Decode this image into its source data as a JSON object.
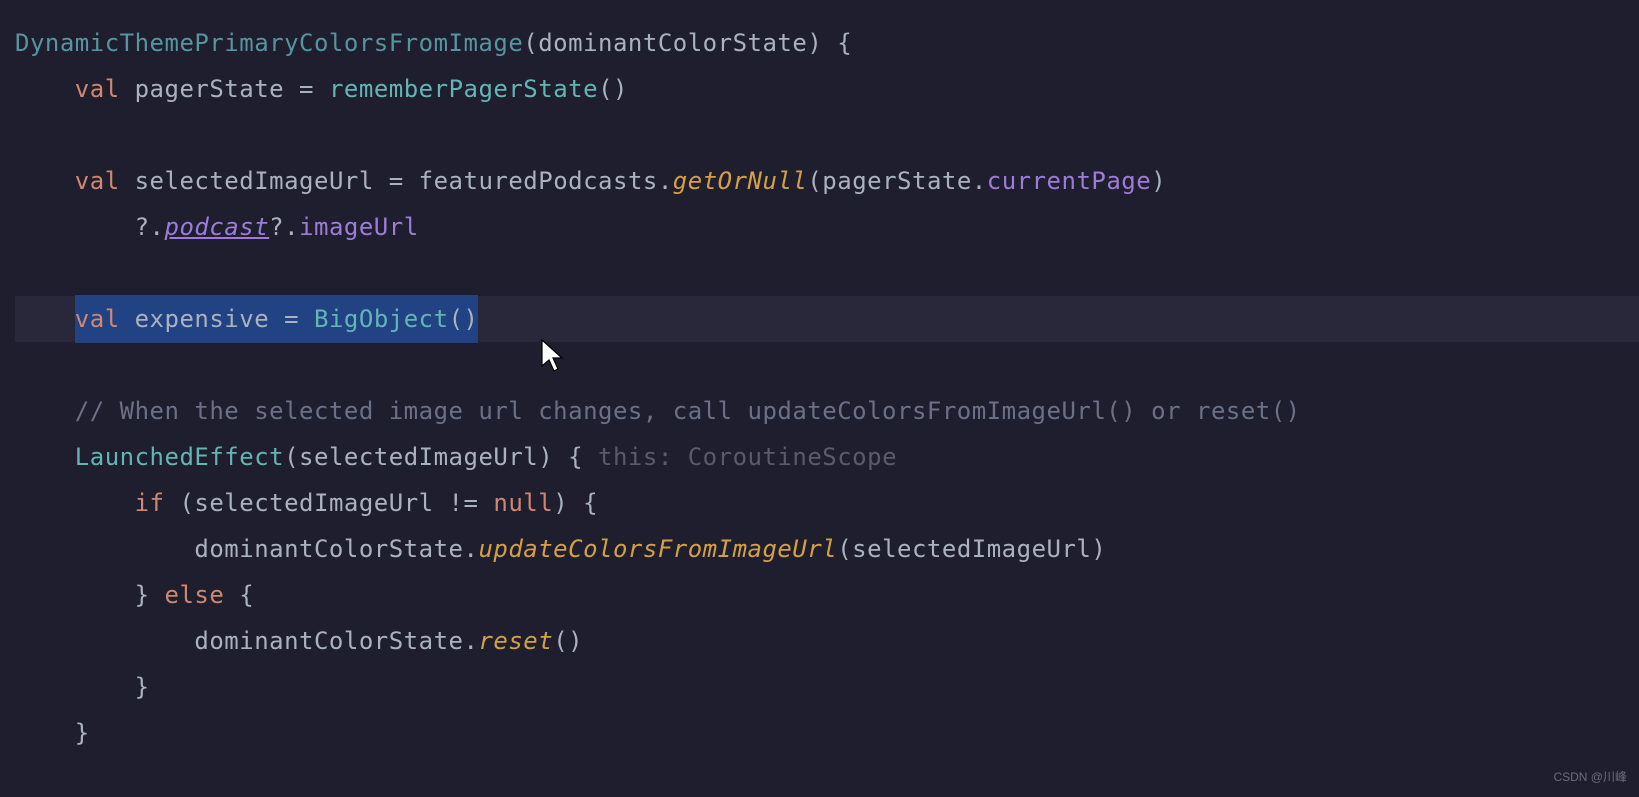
{
  "code": {
    "l1": {
      "funcName": "DynamicThemePrimaryColorsFromImage",
      "param": "dominantColorState",
      "brace": " {"
    },
    "l2": {
      "indent": "    ",
      "kw": "val",
      "sp": " ",
      "name": "pagerState",
      "eq": " = ",
      "func": "rememberPagerState",
      "parens": "()"
    },
    "l3": {
      "indent": "    ",
      "kw": "val",
      "sp": " ",
      "name": "selectedImageUrl",
      "eq": " = ",
      "obj": "featuredPodcasts",
      "dot": ".",
      "method": "getOrNull",
      "open": "(",
      "arg1": "pagerState",
      "dot2": ".",
      "prop": "currentPage",
      "close": ")"
    },
    "l4": {
      "indent": "        ",
      "safe1": "?.",
      "podcast": "podcast",
      "safe2": "?.",
      "imageUrl": "imageUrl"
    },
    "l5": {
      "indent": "    ",
      "kw": "val",
      "sp": " ",
      "name": "expensive",
      "eq": " = ",
      "func": "BigObject",
      "parens": "()"
    },
    "l6": {
      "indent": "    ",
      "comment": "// When the selected image url changes, call updateColorsFromImageUrl() or reset()"
    },
    "l7": {
      "indent": "    ",
      "func": "LaunchedEffect",
      "open": "(",
      "arg": "selectedImageUrl",
      "close": ") { ",
      "hint": "this: CoroutineScope"
    },
    "l8": {
      "indent": "        ",
      "kw": "if",
      "cond": " (selectedImageUrl != ",
      "null": "null",
      "rest": ") {"
    },
    "l9": {
      "indent": "            ",
      "obj": "dominantColorState",
      "dot": ".",
      "method": "updateColorsFromImageUrl",
      "open": "(",
      "arg": "selectedImageUrl",
      "close": ")"
    },
    "l10": {
      "indent": "        ",
      "brace": "} ",
      "else": "else",
      "rest": " {"
    },
    "l11": {
      "indent": "            ",
      "obj": "dominantColorState",
      "dot": ".",
      "method": "reset",
      "parens": "()"
    },
    "l12": {
      "indent": "        ",
      "brace": "}"
    },
    "l13": {
      "indent": "    ",
      "brace": "}"
    }
  },
  "watermark": "CSDN @川峰"
}
